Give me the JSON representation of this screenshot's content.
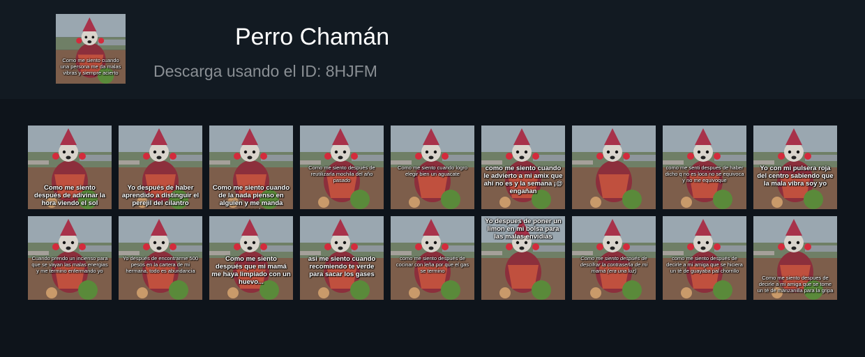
{
  "header": {
    "title": "Perro Chamán",
    "subtitle": "Descarga usando el ID: 8HJFM",
    "thumb_caption": "Como me siento cuando una persona me da malas vibras y siempre acierto"
  },
  "stickers": [
    {
      "caption": "Como me siento después de adivinar la hora viendo el sol"
    },
    {
      "caption": "Yo después de haber aprendido a distinguir el perejil del cilantro"
    },
    {
      "caption": "Como me siento cuando de la nada pienso en alguien y me manda mensaje"
    },
    {
      "caption": "Como me siento después de reutilizarla mochila del año pasado"
    },
    {
      "caption": "Como me siento cuando logro elegir bien un aguacate"
    },
    {
      "caption": "como me siento cuando le advierto a mi amix que ahí no es y la semana ¡@ engañan"
    },
    {
      "caption": ""
    },
    {
      "caption": "como me senti despues de haber dicho q no es loca no se equivoca y no me equivoque"
    },
    {
      "caption": "Yo con mi pulsera roja del centro sabiendo que la mala vibra soy yo"
    },
    {
      "caption": "Cuando prendo un incienso para que se vayan las malas energias y me termino enfermando yo"
    },
    {
      "caption": "Yo después de encontrarme 500 pesos en la cartera de mi hermana, todo es abundancia"
    },
    {
      "caption": "Como me siento después que mi mamá me haya limpiado con un huevo..."
    },
    {
      "caption": "asi me siento cuando recomiendo te verde para sacar los gases"
    },
    {
      "caption": "como me siento después de cocinar con leña por que el gas se termino"
    },
    {
      "caption": "Yo despues de poner un limon en mi bolsa para las malas envidias"
    },
    {
      "caption": "Como me siento después de descifrar la contraseña de mi mamá (era una luz)"
    },
    {
      "caption": "como me siento después de decirle a mi amiga que se hiciera un té de guayaba pal chorrillo"
    },
    {
      "caption": "Como me siento despues de decirle a mi amiga que se tome un té de manzanilla para la gripa"
    }
  ]
}
